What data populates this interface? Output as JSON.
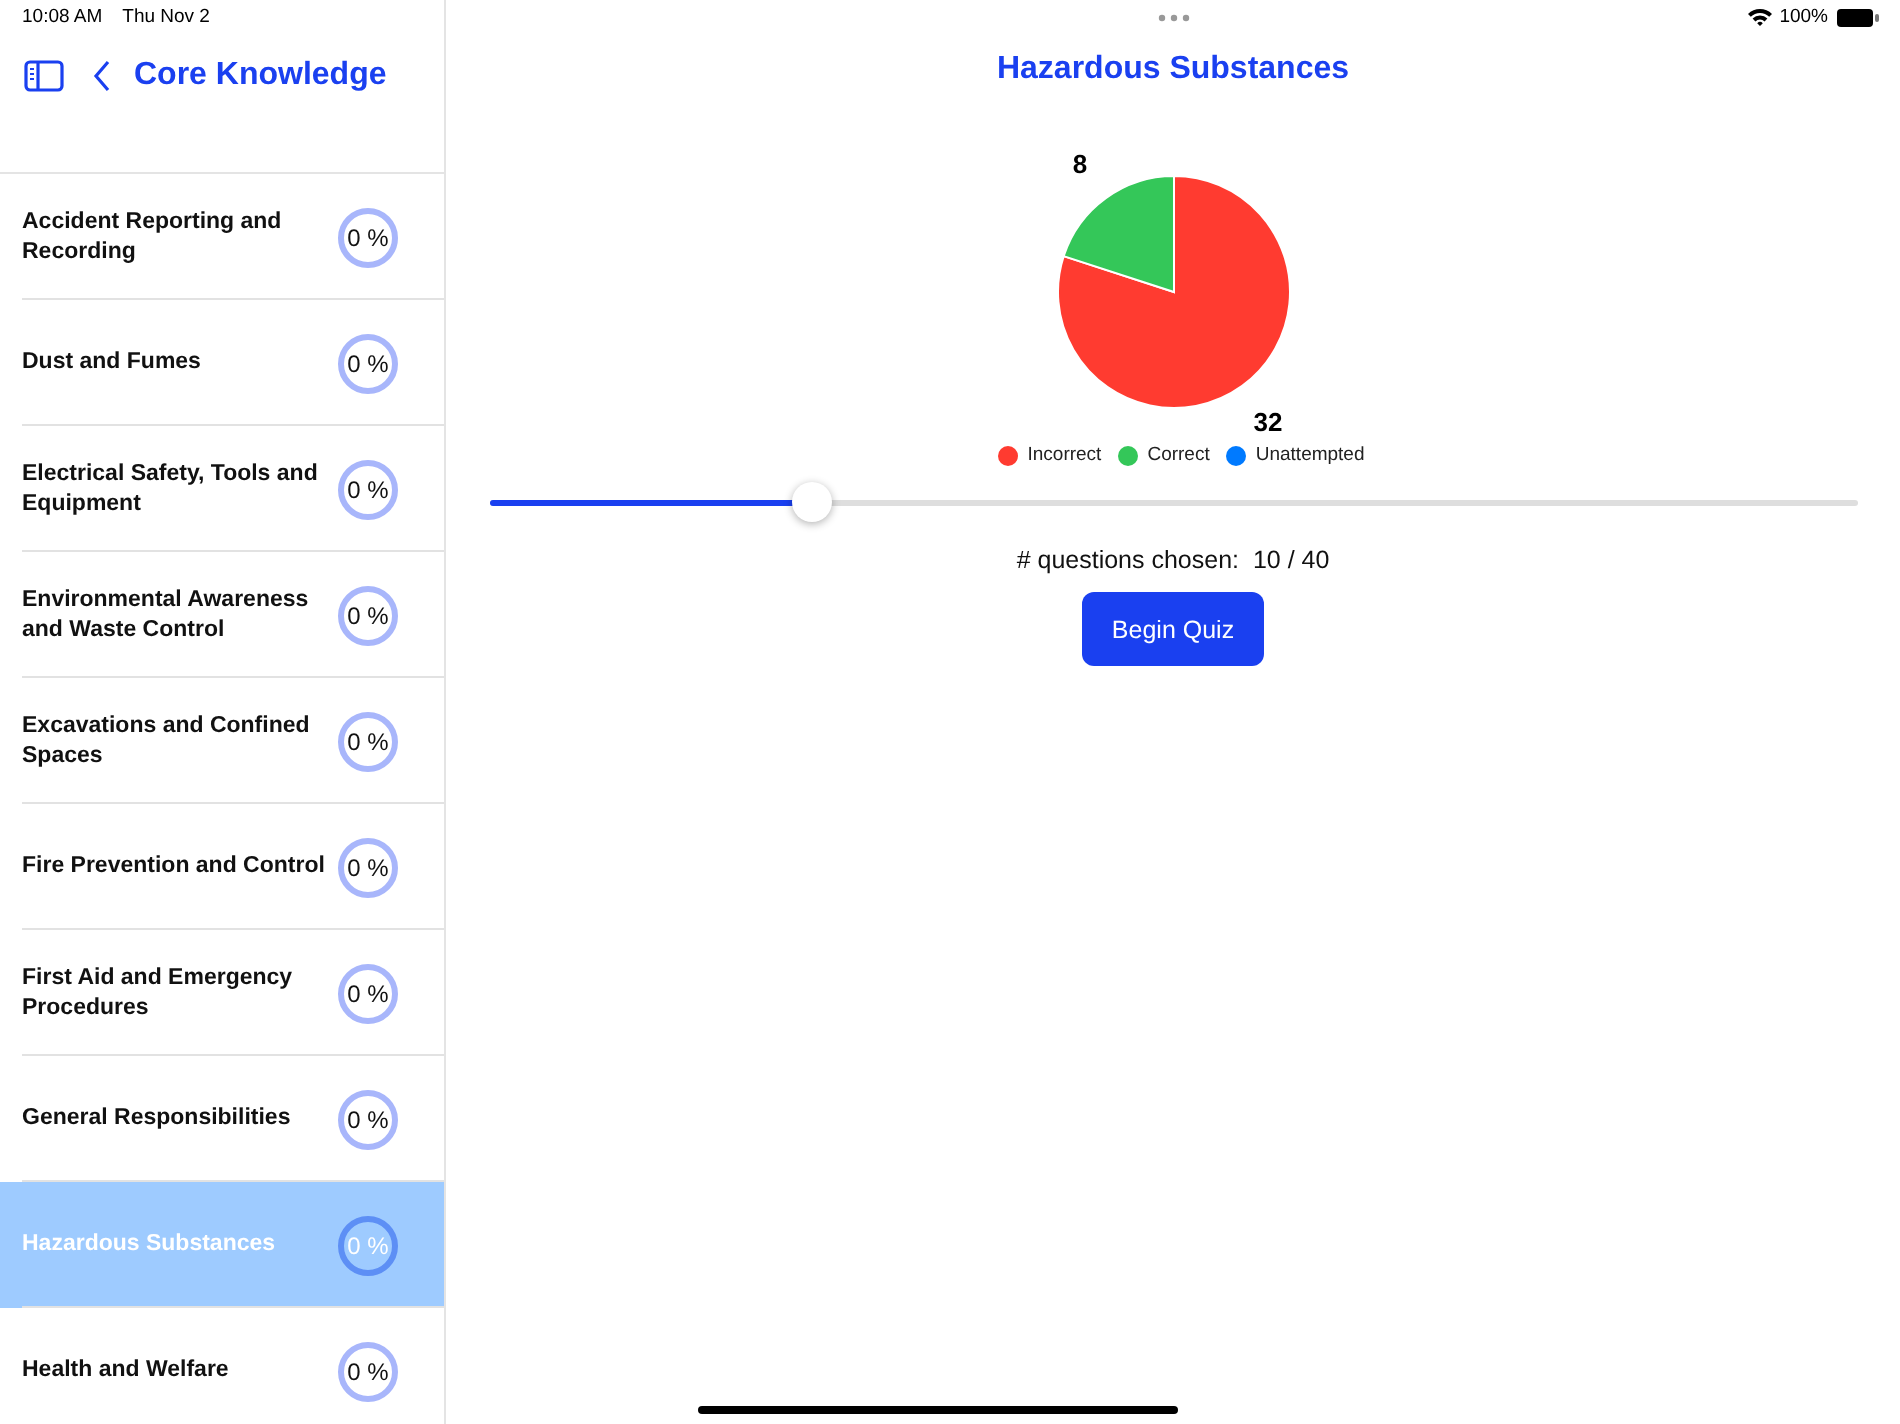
{
  "status_bar": {
    "time": "10:08 AM",
    "date": "Thu Nov 2",
    "battery": "100%"
  },
  "sidebar": {
    "back_title": "Core Knowledge",
    "items": [
      {
        "title": "Accident Reporting and Recording",
        "percent": "0 %",
        "selected": false
      },
      {
        "title": "Dust and Fumes",
        "percent": "0 %",
        "selected": false
      },
      {
        "title": "Electrical Safety, Tools and Equipment",
        "percent": "0 %",
        "selected": false
      },
      {
        "title": "Environmental Awareness and Waste Control",
        "percent": "0 %",
        "selected": false
      },
      {
        "title": "Excavations and Confined Spaces",
        "percent": "0 %",
        "selected": false
      },
      {
        "title": "Fire Prevention and Control",
        "percent": "0 %",
        "selected": false
      },
      {
        "title": "First Aid and Emergency Procedures",
        "percent": "0 %",
        "selected": false
      },
      {
        "title": "General Responsibilities",
        "percent": "0 %",
        "selected": false
      },
      {
        "title": "Hazardous Substances",
        "percent": "0 %",
        "selected": true
      },
      {
        "title": "Health and Welfare",
        "percent": "0 %",
        "selected": false
      }
    ]
  },
  "main": {
    "title": "Hazardous Substances",
    "chart_data": {
      "type": "pie",
      "categories": [
        "Incorrect",
        "Correct",
        "Unattempted"
      ],
      "values": [
        32,
        8,
        0
      ],
      "colors": [
        "#ff3b30",
        "#34c759",
        "#007aff"
      ],
      "data_labels": true,
      "legend": "bottom"
    },
    "slider": {
      "level": 0.236
    },
    "questions_label": "# questions chosen:  10 / 40",
    "begin_button": "Begin Quiz"
  }
}
